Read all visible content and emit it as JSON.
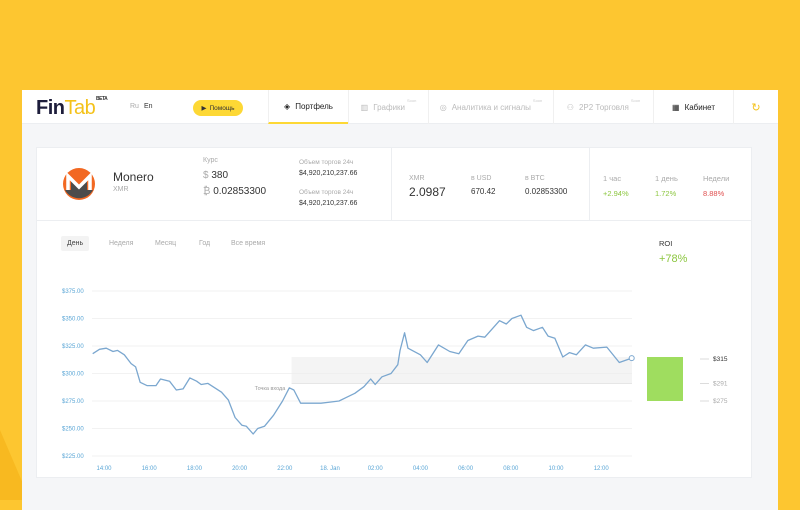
{
  "header": {
    "logo_a": "Fin",
    "logo_b": "Tab",
    "beta": "BETA",
    "lang_ru": "Ru",
    "lang_en": "En",
    "help": "Помощь",
    "tabs": [
      {
        "label": "Портфель",
        "badge": ""
      },
      {
        "label": "Графики",
        "badge": "Soon"
      },
      {
        "label": "Аналитика и сигналы",
        "badge": "Soon"
      },
      {
        "label": "2P2 Торговля",
        "badge": "Soon"
      },
      {
        "label": "Кабинет",
        "badge": ""
      }
    ]
  },
  "coin": {
    "name": "Monero",
    "ticker": "XMR",
    "rate_label": "Курс",
    "usd_symbol": "$",
    "usd": "380",
    "btc_symbol": "₿",
    "btc": "0.02853300",
    "vol_label_1": "Объем торгов 24ч",
    "vol_1": "$4,920,210,237.66",
    "vol_label_2": "Объем торгов 24ч",
    "vol_2": "$4,920,210,237.66"
  },
  "holding": {
    "amount_label": "XMR",
    "amount": "2.0987",
    "usd_label": "в USD",
    "usd": "670.42",
    "btc_label": "в BTC",
    "btc": "0.02853300"
  },
  "changes": [
    {
      "label": "1 час",
      "value": "+2.94%",
      "color": "#8cc63f"
    },
    {
      "label": "1 день",
      "value": "1.72%",
      "color": "#8cc63f"
    },
    {
      "label": "Недели",
      "value": "8.88%",
      "color": "#e05050"
    }
  ],
  "ranges": [
    "День",
    "Неделя",
    "Месяц",
    "Год",
    "Все время"
  ],
  "roi": {
    "label": "ROI",
    "value": "+78%"
  },
  "chart_data": {
    "type": "line",
    "title": "",
    "xlabel": "",
    "ylabel": "",
    "ylim": [
      225,
      375
    ],
    "yticks": [
      "$375.00",
      "$350.00",
      "$325.00",
      "$300.00",
      "$275.00",
      "$250.00",
      "$225.00"
    ],
    "ytick_values": [
      375,
      350,
      325,
      300,
      275,
      250,
      225
    ],
    "xticks": [
      "14:00",
      "16:00",
      "18:00",
      "20:00",
      "22:00",
      "18. Jan",
      "02:00",
      "04:00",
      "06:00",
      "08:00",
      "10:00",
      "12:00"
    ],
    "xtick_hours": [
      14,
      16,
      18,
      20,
      22,
      24,
      26,
      28,
      30,
      32,
      34,
      36
    ],
    "series": [
      {
        "name": "XMR price",
        "color": "#7ba7cf",
        "x": [
          13.5,
          13.8,
          14.1,
          14.4,
          14.6,
          14.9,
          15.2,
          15.4,
          15.6,
          15.9,
          16.3,
          16.5,
          16.9,
          17.2,
          17.5,
          17.8,
          18.1,
          18.3,
          18.6,
          18.9,
          19.2,
          19.5,
          19.8,
          20.1,
          20.3,
          20.6,
          20.8,
          21.1,
          21.5,
          21.9,
          22.2,
          22.4,
          22.7,
          23.1,
          23.6,
          24.0,
          24.4,
          24.7,
          25.1,
          25.5,
          25.8,
          26.0,
          26.3,
          26.7,
          27.0,
          27.1,
          27.3,
          27.45,
          28.0,
          28.3,
          28.8,
          29.3,
          29.7,
          30.1,
          30.55,
          30.85,
          31.5,
          31.8,
          32.05,
          32.45,
          32.7,
          33.0,
          33.4,
          33.65,
          33.95,
          34.3,
          34.6,
          34.9,
          35.3,
          35.65,
          36.25,
          36.8,
          37.35
        ],
        "y": [
          318,
          322,
          323,
          320,
          321,
          317,
          309,
          306,
          292,
          289,
          289,
          295,
          293,
          285,
          286,
          296,
          293,
          290,
          291,
          287,
          283,
          276,
          260,
          253,
          252,
          245,
          250,
          252,
          262,
          275,
          287,
          285,
          273,
          273,
          273,
          274,
          275,
          278,
          282,
          288,
          295,
          290,
          297,
          300,
          308,
          321,
          337,
          323,
          317,
          310,
          326,
          320,
          318,
          330,
          334,
          333,
          348,
          345,
          350,
          353,
          342,
          339,
          342,
          334,
          332,
          315,
          319,
          317,
          326,
          323,
          324,
          310,
          314
        ]
      }
    ],
    "entry": {
      "label": "Точка входа",
      "x": 22.2,
      "y": 287
    },
    "band": {
      "from_x": 22.3,
      "low": 291,
      "high": 315
    },
    "levels": [
      "$315",
      "$291",
      "$275"
    ]
  }
}
